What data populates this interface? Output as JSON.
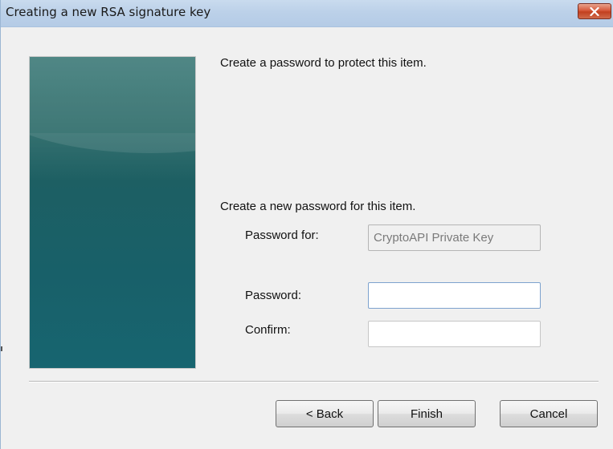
{
  "window": {
    "title": "Creating a new RSA signature key",
    "close_icon": "close-icon"
  },
  "content": {
    "heading": "Create a password to protect this item.",
    "subheading": "Create a new password for this item.",
    "password_for_label": "Password for:",
    "password_for_value": "CryptoAPI Private Key",
    "password_label": "Password:",
    "password_value": "",
    "confirm_label": "Confirm:",
    "confirm_value": ""
  },
  "buttons": {
    "back": "< Back",
    "finish": "Finish",
    "cancel": "Cancel"
  },
  "colors": {
    "close_button": "#c2401f",
    "side_panel": "#1d5f63",
    "title_bar": "#bcd1e9"
  }
}
